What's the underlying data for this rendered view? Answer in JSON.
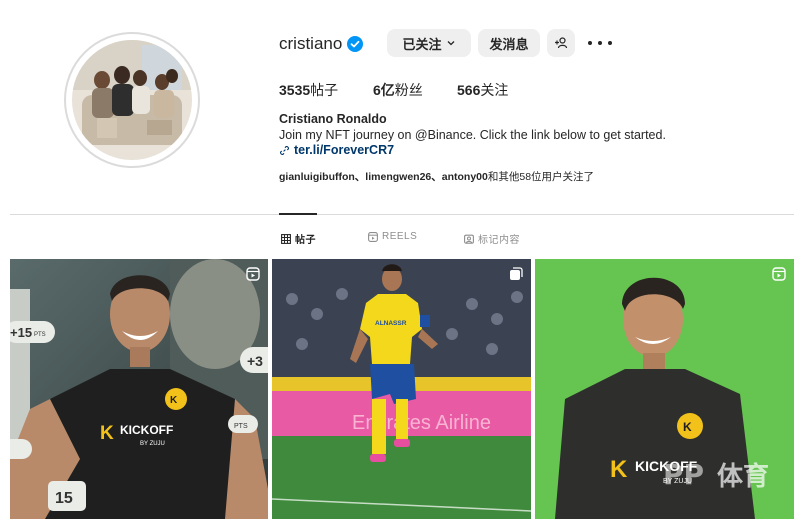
{
  "profile": {
    "username": "cristiano",
    "follow_button": "已关注",
    "message_button": "发消息",
    "stats": {
      "posts_value": "3535",
      "posts_label": "帖子",
      "followers_value": "6亿",
      "followers_label": "粉丝",
      "following_value": "566",
      "following_label": "关注"
    },
    "full_name": "Cristiano Ronaldo",
    "bio": "Join my NFT journey on @Binance. Click the link below to get started.",
    "link": "ter.li/ForeverCR7",
    "followed_by_names": "gianluigibuffon、limengwen26、antony00",
    "followed_by_suffix": "和其他58位用户关注了"
  },
  "tabs": [
    {
      "label": "帖子",
      "icon": "grid-icon"
    },
    {
      "label": "REELS",
      "icon": "reels-icon"
    },
    {
      "label": "标记内容",
      "icon": "tagged-icon"
    }
  ],
  "posts": [
    {
      "type_icon": "reels-icon",
      "overlay": [
        "+15",
        "PTS",
        "+3",
        "PTS",
        "15"
      ],
      "shirt_text": "KICKOFF",
      "shirt_sub": "BY ZUJU"
    },
    {
      "type_icon": "carousel-icon",
      "ad_text": "Emirates Airline",
      "shirt_text": "ALNASSR"
    },
    {
      "type_icon": "reels-icon",
      "shirt_text": "KICKOFF",
      "shirt_sub": "BY ZUJU",
      "watermark": "体育"
    }
  ],
  "colors": {
    "verified": "#0095f6",
    "link": "#00376b",
    "green_screen": "#5fc14a",
    "nassr_yellow": "#f4d81c",
    "kickoff_yellow": "#f2c21a"
  }
}
